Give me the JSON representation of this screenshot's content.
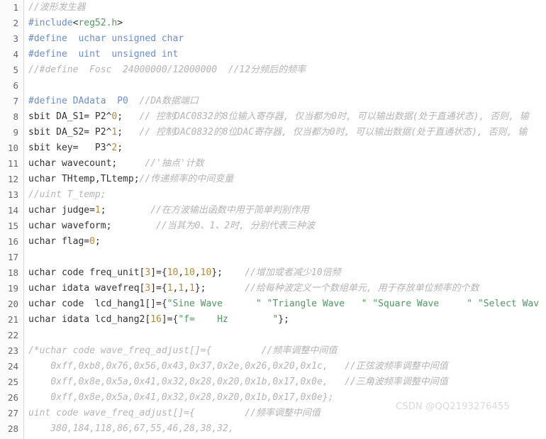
{
  "editor": {
    "language": "c",
    "first_line_number": 1,
    "total_visible_lines": 28,
    "colors": {
      "background": "#ffffff",
      "gutter_background": "#fbfbfb",
      "gutter_rule": "#d7d7d7",
      "line_number": "#666666",
      "plain_text": "#333333",
      "comment": "#b4b4b4",
      "preprocessor": "#6a8dd4",
      "string": "#4f9a62",
      "number": "#b58a2d"
    }
  },
  "lines": [
    {
      "n": "1",
      "tokens": [
        {
          "t": "comment",
          "s": "//波形发生器"
        }
      ]
    },
    {
      "n": "2",
      "tokens": [
        {
          "t": "pre",
          "s": "#include"
        },
        {
          "t": "plain",
          "s": "<"
        },
        {
          "t": "string",
          "s": "reg52.h"
        },
        {
          "t": "plain",
          "s": ">"
        }
      ]
    },
    {
      "n": "3",
      "tokens": [
        {
          "t": "pre",
          "s": "#define"
        },
        {
          "t": "plain",
          "s": "  "
        },
        {
          "t": "kw",
          "s": "uchar unsigned char"
        }
      ]
    },
    {
      "n": "4",
      "tokens": [
        {
          "t": "pre",
          "s": "#define"
        },
        {
          "t": "plain",
          "s": "  "
        },
        {
          "t": "kw",
          "s": "uint  unsigned int"
        }
      ]
    },
    {
      "n": "5",
      "tokens": [
        {
          "t": "comment",
          "s": "//#define  Fosc  24000000/12000000  //12分频后的频率"
        }
      ]
    },
    {
      "n": "6",
      "tokens": []
    },
    {
      "n": "7",
      "tokens": [
        {
          "t": "pre",
          "s": "#define DAdata"
        },
        {
          "t": "plain",
          "s": "  "
        },
        {
          "t": "pre",
          "s": "P0"
        },
        {
          "t": "plain",
          "s": "  "
        },
        {
          "t": "comment",
          "s": "//DA数据端口"
        }
      ]
    },
    {
      "n": "8",
      "tokens": [
        {
          "t": "plain",
          "s": "sbit DA_S1= P2^"
        },
        {
          "t": "number",
          "s": "0"
        },
        {
          "t": "plain",
          "s": ";   "
        },
        {
          "t": "comment",
          "s": "// 控制DAC0832的8位输入寄存器, 仅当都为0时, 可以输出数据(处于直通状态), 否则, 输"
        }
      ]
    },
    {
      "n": "9",
      "tokens": [
        {
          "t": "plain",
          "s": "sbit DA_S2= P2^"
        },
        {
          "t": "number",
          "s": "1"
        },
        {
          "t": "plain",
          "s": ";   "
        },
        {
          "t": "comment",
          "s": "// 控制DAC0832的8位DAC寄存器, 仅当都为0时, 可以输出数据(处于直通状态), 否则, 输"
        }
      ]
    },
    {
      "n": "10",
      "tokens": [
        {
          "t": "plain",
          "s": "sbit key=   P3^"
        },
        {
          "t": "number",
          "s": "2"
        },
        {
          "t": "plain",
          "s": ";"
        }
      ]
    },
    {
      "n": "11",
      "tokens": [
        {
          "t": "plain",
          "s": "uchar wavecount;"
        },
        {
          "t": "plain",
          "s": "     "
        },
        {
          "t": "comment",
          "s": "//'抽点'计数"
        }
      ]
    },
    {
      "n": "12",
      "tokens": [
        {
          "t": "plain",
          "s": "uchar THtemp,TLtemp;"
        },
        {
          "t": "comment",
          "s": "//传递频率的中间变量"
        }
      ]
    },
    {
      "n": "13",
      "tokens": [
        {
          "t": "comment",
          "s": "//uint T_temp;"
        }
      ]
    },
    {
      "n": "14",
      "tokens": [
        {
          "t": "plain",
          "s": "uchar judge="
        },
        {
          "t": "number",
          "s": "1"
        },
        {
          "t": "plain",
          "s": ";"
        },
        {
          "t": "plain",
          "s": "        "
        },
        {
          "t": "comment",
          "s": "//在方波输出函数中用于简单判别作用"
        }
      ]
    },
    {
      "n": "15",
      "tokens": [
        {
          "t": "plain",
          "s": "uchar waveform;"
        },
        {
          "t": "plain",
          "s": "        "
        },
        {
          "t": "comment",
          "s": "//当其为0、1、2时, 分别代表三种波"
        }
      ]
    },
    {
      "n": "16",
      "tokens": [
        {
          "t": "plain",
          "s": "uchar flag="
        },
        {
          "t": "number",
          "s": "0"
        },
        {
          "t": "plain",
          "s": ";"
        }
      ]
    },
    {
      "n": "17",
      "tokens": []
    },
    {
      "n": "18",
      "tokens": [
        {
          "t": "plain",
          "s": "uchar code freq_unit["
        },
        {
          "t": "number",
          "s": "3"
        },
        {
          "t": "plain",
          "s": "]={"
        },
        {
          "t": "number",
          "s": "10"
        },
        {
          "t": "plain",
          "s": ","
        },
        {
          "t": "number",
          "s": "10"
        },
        {
          "t": "plain",
          "s": ","
        },
        {
          "t": "number",
          "s": "10"
        },
        {
          "t": "plain",
          "s": "};"
        },
        {
          "t": "plain",
          "s": "    "
        },
        {
          "t": "comment",
          "s": "//增加或者减少10倍频"
        }
      ]
    },
    {
      "n": "19",
      "tokens": [
        {
          "t": "plain",
          "s": "uchar idata wavefreq["
        },
        {
          "t": "number",
          "s": "3"
        },
        {
          "t": "plain",
          "s": "]={"
        },
        {
          "t": "number",
          "s": "1"
        },
        {
          "t": "plain",
          "s": ","
        },
        {
          "t": "number",
          "s": "1"
        },
        {
          "t": "plain",
          "s": ","
        },
        {
          "t": "number",
          "s": "1"
        },
        {
          "t": "plain",
          "s": "};"
        },
        {
          "t": "plain",
          "s": "       "
        },
        {
          "t": "comment",
          "s": "//给每种波定义一个数组单元, 用于存放单位频率的个数"
        }
      ]
    },
    {
      "n": "20",
      "tokens": [
        {
          "t": "plain",
          "s": "uchar code  lcd_hang1[]={"
        },
        {
          "t": "string",
          "s": "\"Sine Wave      \" \"Triangle Wave   \" \"Square Wave     \" \"Select Wav"
        }
      ]
    },
    {
      "n": "21",
      "tokens": [
        {
          "t": "plain",
          "s": "uchar idata lcd_hang2["
        },
        {
          "t": "number",
          "s": "16"
        },
        {
          "t": "plain",
          "s": "]={"
        },
        {
          "t": "string",
          "s": "\"f=    Hz        \""
        },
        {
          "t": "plain",
          "s": "};"
        }
      ]
    },
    {
      "n": "22",
      "tokens": []
    },
    {
      "n": "23",
      "tokens": [
        {
          "t": "comment",
          "s": "/*uchar code wave_freq_adjust[]={         //频率调整中间值"
        }
      ]
    },
    {
      "n": "24",
      "tokens": [
        {
          "t": "comment",
          "s": "    0xff,0xb8,0x76,0x56,0x43,0x37,0x2e,0x26,0x20,0x1c,   //正弦波频率调整中间值"
        }
      ]
    },
    {
      "n": "25",
      "tokens": [
        {
          "t": "comment",
          "s": "    0xff,0x8e,0x5a,0x41,0x32,0x28,0x20,0x1b,0x17,0x0e,   //三角波频率调整中间值"
        }
      ]
    },
    {
      "n": "26",
      "tokens": [
        {
          "t": "comment",
          "s": "    0xff,0x8e,0x5a,0x41,0x32,0x28,0x20,0x1b,0x17,0x0e};"
        }
      ]
    },
    {
      "n": "27",
      "tokens": [
        {
          "t": "comment",
          "s": "uint code wave_freq_adjust[]={         //频率调整中间值"
        }
      ]
    },
    {
      "n": "28",
      "tokens": [
        {
          "t": "comment",
          "s": "    380,184,118,86,67,55,46,28,38,32,"
        }
      ]
    }
  ],
  "watermark": {
    "text": "CSDN @QQ2193276455"
  }
}
